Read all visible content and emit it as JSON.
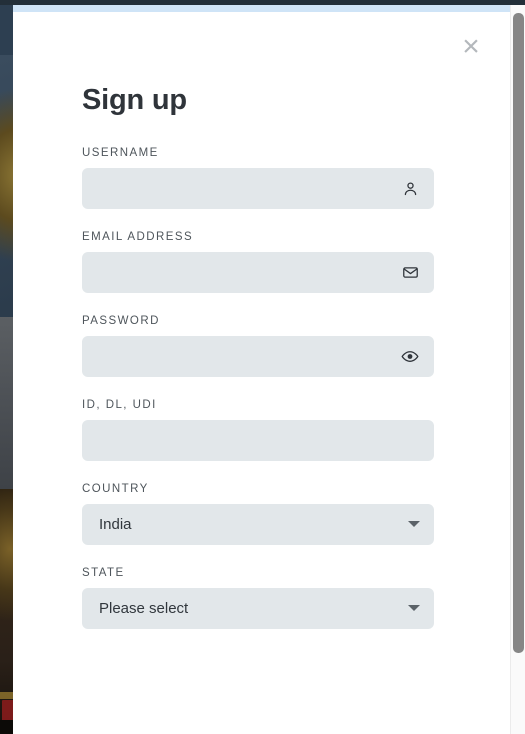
{
  "window": {
    "accent_color": "#cfe4f7",
    "chrome_color": "#232f39"
  },
  "modal": {
    "title": "Sign up",
    "close_label": "×",
    "close_icon": "close-icon"
  },
  "form": {
    "fields": [
      {
        "id": "username",
        "label": "USERNAME",
        "value": "",
        "placeholder": "",
        "icon": "user-icon",
        "type": "text"
      },
      {
        "id": "email",
        "label": "EMAIL ADDRESS",
        "value": "",
        "placeholder": "",
        "icon": "envelope-icon",
        "type": "text"
      },
      {
        "id": "password",
        "label": "PASSWORD",
        "value": "",
        "placeholder": "",
        "icon": "eye-icon",
        "type": "password"
      },
      {
        "id": "id_dl_udi",
        "label": "ID, DL, UDI",
        "value": "",
        "placeholder": "",
        "icon": "",
        "type": "text"
      }
    ],
    "selects": [
      {
        "id": "country",
        "label": "COUNTRY",
        "value": "India",
        "caret_icon": "chevron-down-icon"
      },
      {
        "id": "state",
        "label": "STATE",
        "value": "Please select",
        "caret_icon": "chevron-down-icon"
      }
    ]
  },
  "scrollbar": {
    "thumb_color": "#868686",
    "track_color": "#fafafa"
  }
}
